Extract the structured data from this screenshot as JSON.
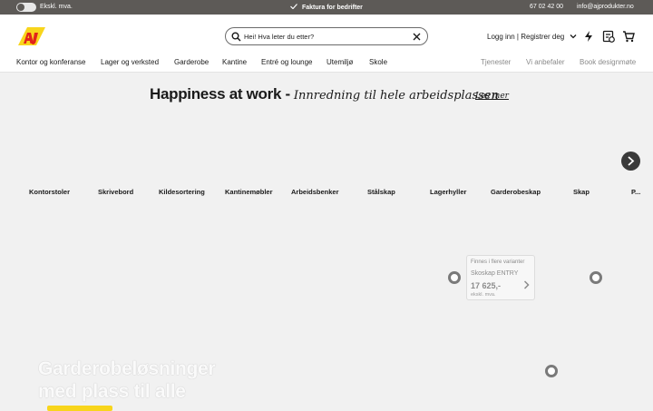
{
  "topbar": {
    "vat_toggle_label": "Ekskl. mva.",
    "invoice_label": "Faktura for bedrifter",
    "phone": "67 02 42 00",
    "email": "info@ajprodukter.no"
  },
  "header": {
    "search_placeholder": "Hei! Hva leter du etter?",
    "login_label": "Logg inn | Registrer deg"
  },
  "nav": {
    "left": [
      "Kontor og konferanse",
      "Lager og verksted",
      "Garderobe",
      "Kantine",
      "Entré og lounge",
      "Utemiljø",
      "Skole"
    ],
    "right": [
      "Tjenester",
      "Vi anbefaler",
      "Book designmøte"
    ]
  },
  "hero": {
    "title_bold": "Happiness at work -",
    "title_script": "Innredning til hele arbeidsplassen",
    "read_more": "Les mer"
  },
  "categories": [
    "Kontorstoler",
    "Skrivebord",
    "Kildesortering",
    "Kantinemøbler",
    "Arbeidsbenker",
    "Stålskap",
    "Lagerhyller",
    "Garderobeskap",
    "Skap",
    "P..."
  ],
  "product_card": {
    "variants": "Finnes i flere varianter",
    "name": "Skoskap ENTRY",
    "price": "17 625,-",
    "vat": "ekskl. mva."
  },
  "banner": {
    "line1": "Garderobeløsninger",
    "line2": "med plass til alle"
  },
  "colors": {
    "topbar_bg": "#5d5a57",
    "page_bg": "#f1f1f1",
    "brand_red": "#e2231a",
    "brand_yellow": "#f8d51c"
  }
}
